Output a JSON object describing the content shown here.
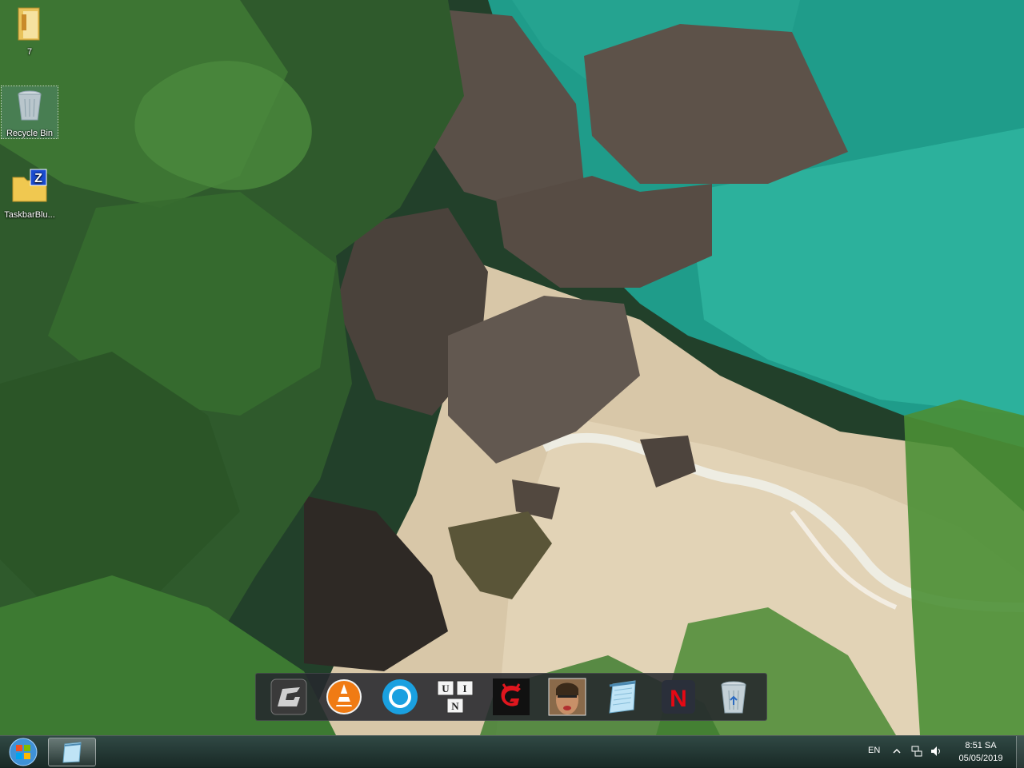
{
  "desktop": {
    "icons": [
      {
        "label": "7"
      },
      {
        "label": "Recycle Bin"
      },
      {
        "label": "TaskbarBlu..."
      }
    ]
  },
  "dock": {
    "items": [
      {
        "icon": "nvidia-geforce-icon"
      },
      {
        "icon": "vlc-icon"
      },
      {
        "icon": "cortana-circle-icon"
      },
      {
        "icon": "unikey-icon",
        "letters": [
          "U",
          "I",
          "N"
        ]
      },
      {
        "icon": "garena-icon"
      },
      {
        "icon": "gta-san-andreas-icon"
      },
      {
        "icon": "notepad-icon"
      },
      {
        "icon": "netflix-icon",
        "letter": "N"
      },
      {
        "icon": "recycle-bin-icon"
      }
    ]
  },
  "taskbar": {
    "language": "EN",
    "time": "8:51 SA",
    "date": "05/05/2019",
    "colors": {
      "accent": "#1e7fd0",
      "dock_bg": "#26282e"
    }
  }
}
